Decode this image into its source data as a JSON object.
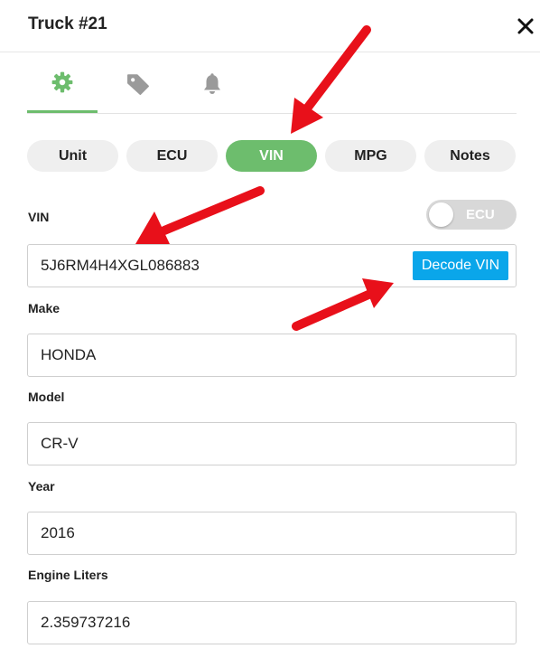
{
  "header": {
    "title": "Truck #21"
  },
  "icons": {
    "close": "close-icon",
    "settings": "gear-icon",
    "tags": "tag-icon",
    "alerts": "bell-icon"
  },
  "colors": {
    "accent": "#6dbd6d",
    "decode": "#0aa6ea",
    "arrow": "#e8101a"
  },
  "segments": [
    "Unit",
    "ECU",
    "VIN",
    "MPG",
    "Notes"
  ],
  "segment_active": "VIN",
  "vin": {
    "label": "VIN",
    "value": "5J6RM4H4XGL086883",
    "decode_label": "Decode VIN",
    "toggle_label": "ECU"
  },
  "make": {
    "label": "Make",
    "value": "HONDA"
  },
  "model": {
    "label": "Model",
    "value": "CR-V"
  },
  "year": {
    "label": "Year",
    "value": "2016"
  },
  "engine": {
    "label": "Engine Liters",
    "value": "2.359737216"
  }
}
